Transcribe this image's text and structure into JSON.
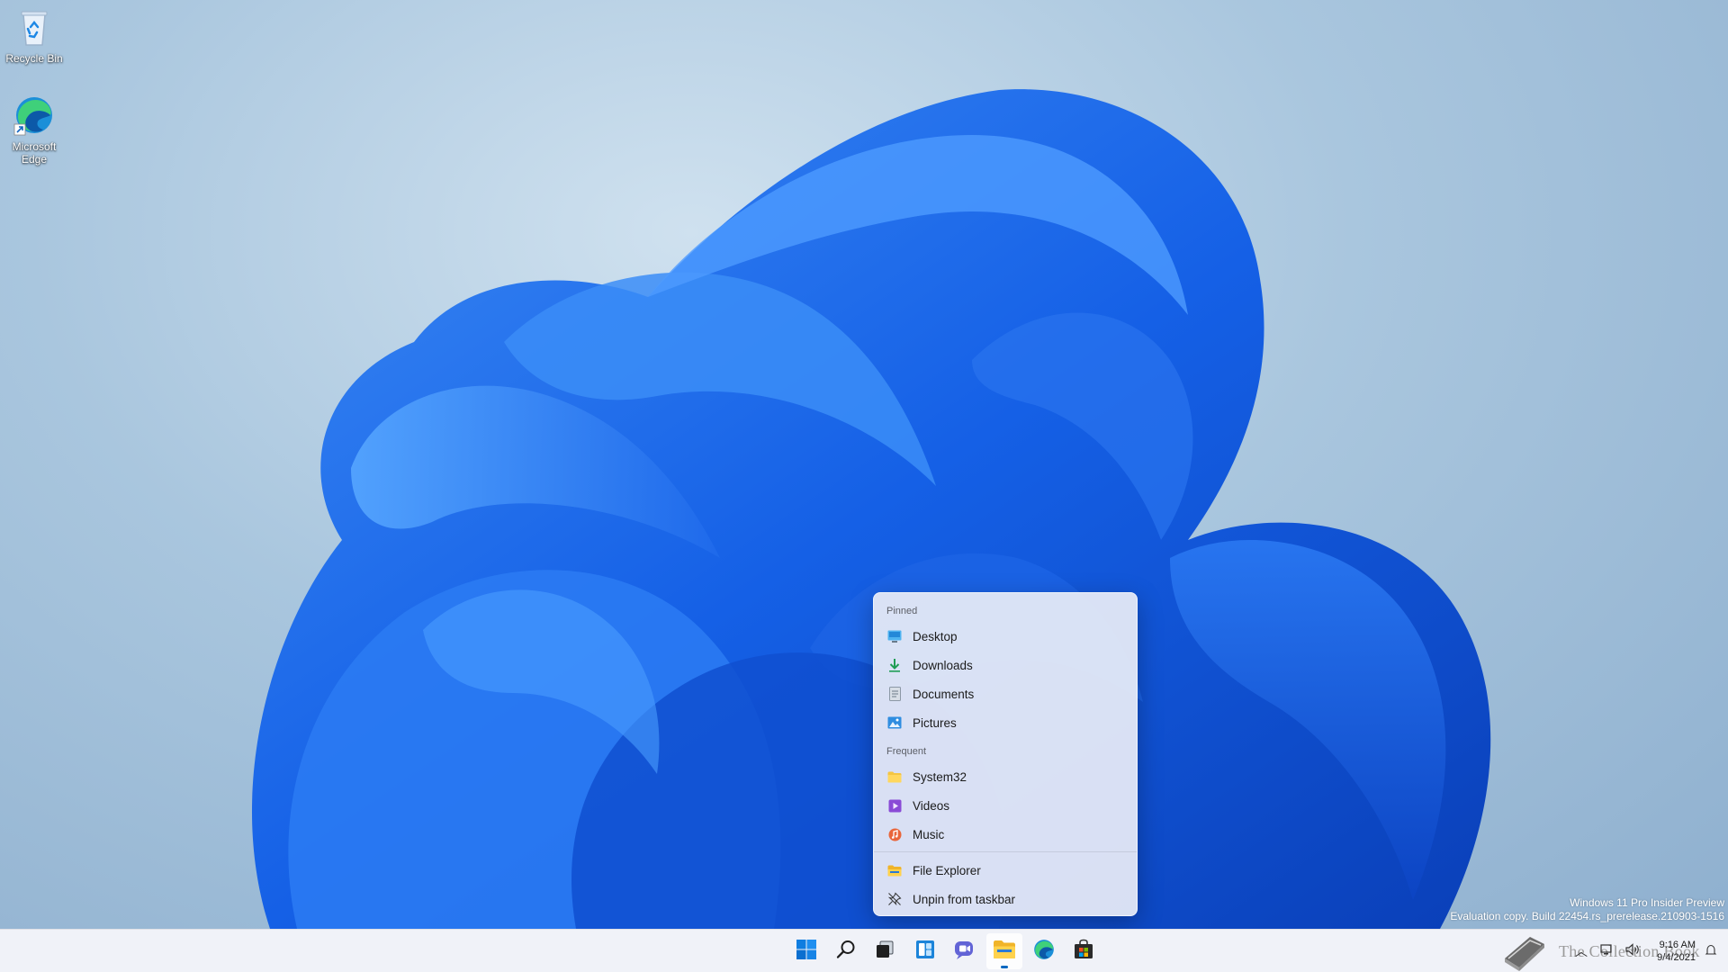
{
  "desktop": {
    "icons": [
      {
        "label": "Recycle Bin"
      },
      {
        "label": "Microsoft Edge"
      }
    ],
    "watermark": {
      "line1": "Windows 11 Pro Insider Preview",
      "line2": "Evaluation copy. Build 22454.rs_prerelease.210903-1516"
    }
  },
  "jumplist": {
    "pinned_header": "Pinned",
    "pinned": [
      {
        "label": "Desktop",
        "icon": "desktop-icon"
      },
      {
        "label": "Downloads",
        "icon": "downloads-icon"
      },
      {
        "label": "Documents",
        "icon": "documents-icon"
      },
      {
        "label": "Pictures",
        "icon": "pictures-icon"
      }
    ],
    "frequent_header": "Frequent",
    "frequent": [
      {
        "label": "System32",
        "icon": "folder-icon"
      },
      {
        "label": "Videos",
        "icon": "videos-icon"
      },
      {
        "label": "Music",
        "icon": "music-icon"
      }
    ],
    "tasks": [
      {
        "label": "File Explorer",
        "icon": "file-explorer-icon"
      },
      {
        "label": "Unpin from taskbar",
        "icon": "unpin-icon"
      }
    ]
  },
  "taskbar": {
    "apps": [
      "start-icon",
      "search-icon",
      "task-view-icon",
      "widgets-icon",
      "chat-icon",
      "file-explorer-icon",
      "edge-icon",
      "store-icon"
    ],
    "active_app": "file-explorer-icon",
    "clock": {
      "time": "9:16 AM",
      "date": "9/4/2021"
    },
    "overlay_text": "The Collection Book"
  },
  "colors": {
    "accent": "#0067c0",
    "wallpaper_blue": "#1a5fe0"
  }
}
